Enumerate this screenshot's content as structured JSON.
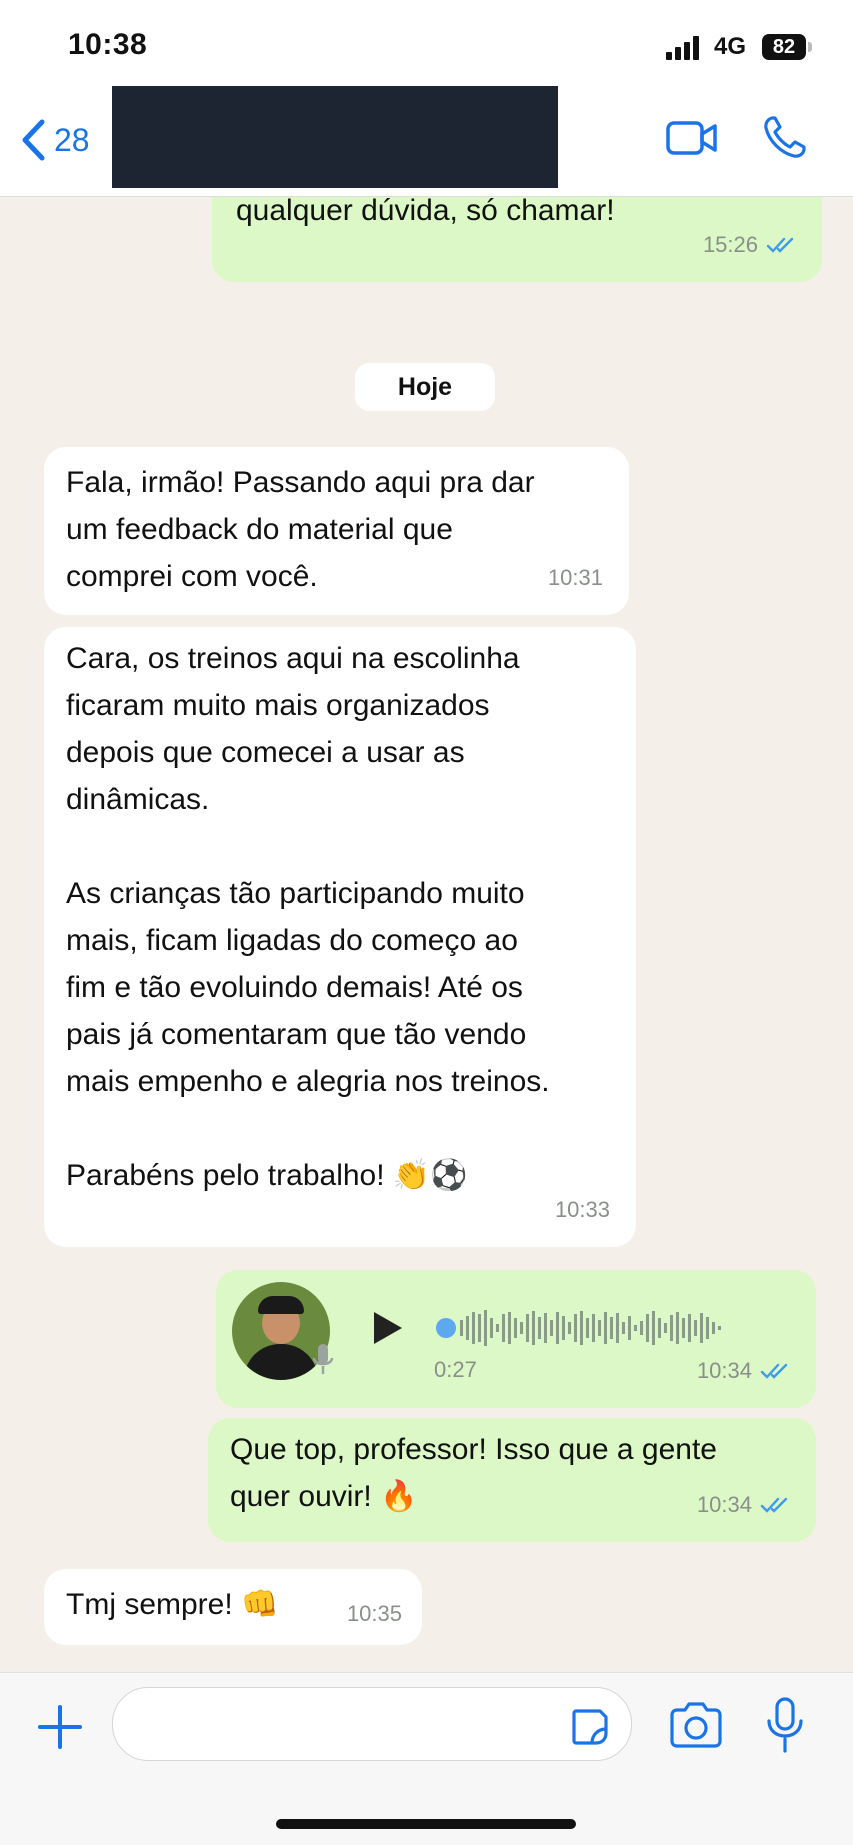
{
  "status_bar": {
    "time": "10:38",
    "network": "4G",
    "battery": "82"
  },
  "header": {
    "back_count": "28",
    "contact_name": ""
  },
  "messages": {
    "m0": {
      "text": "qualquer dúvida, só chamar!",
      "time": "15:26"
    },
    "date_separator": "Hoje",
    "m1": {
      "text": "Fala, irmão! Passando aqui pra dar\num feedback do material que\ncomprei com você.",
      "time": "10:31"
    },
    "m2": {
      "text": "Cara, os treinos aqui na escolinha\nficaram muito mais organizados\ndepois que comecei a usar as\ndinâmicas.\n\nAs crianças tão participando muito\nmais, ficam ligadas do começo ao\nfim e tão evoluindo demais! Até os\npais já comentaram que tão vendo\nmais empenho e alegria nos treinos.\n\nParabéns pelo trabalho! 👏⚽",
      "time": "10:33"
    },
    "m3_audio": {
      "duration": "0:27",
      "time": "10:34"
    },
    "m4": {
      "text": "Que top, professor! Isso que a gente\nquer ouvir! 🔥",
      "time": "10:34"
    },
    "m5": {
      "text": "Tmj sempre! 👊",
      "time": "10:35"
    }
  },
  "colors": {
    "accent": "#1a74e8",
    "outgoing_bubble": "#dcf8c6",
    "incoming_bubble": "#ffffff",
    "chat_background": "#f4efe9"
  },
  "icons": [
    "back-chevron-icon",
    "video-call-icon",
    "phone-icon",
    "double-check-icon",
    "play-icon",
    "mic-icon",
    "plus-icon",
    "sticker-icon",
    "camera-icon"
  ]
}
